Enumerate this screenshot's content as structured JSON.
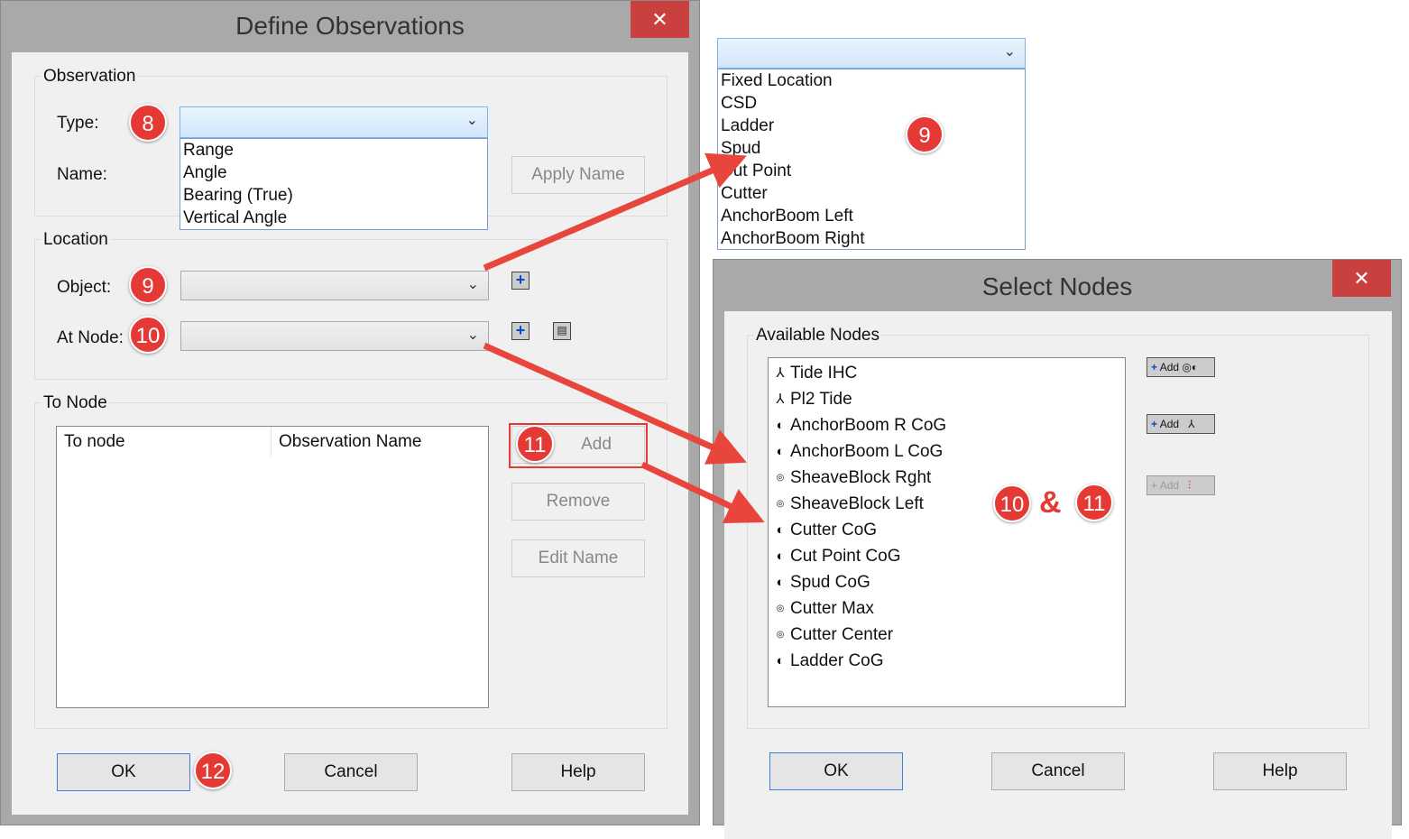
{
  "define": {
    "title": "Define Observations",
    "close": "✕",
    "observation_group": "Observation",
    "type_label": "Type:",
    "name_label": "Name:",
    "apply_name": "Apply Name",
    "type_options": [
      "Range",
      "Angle",
      "Bearing (True)",
      "Vertical Angle"
    ],
    "location_group": "Location",
    "object_label": "Object:",
    "at_node_label": "At Node:",
    "to_node_group": "To Node",
    "columns": [
      "To node",
      "Observation Name"
    ],
    "add": "Add",
    "remove": "Remove",
    "edit_name": "Edit Name",
    "ok": "OK",
    "cancel": "Cancel",
    "help": "Help"
  },
  "object_options": [
    "Fixed Location",
    "CSD",
    "Ladder",
    "Spud",
    "Cut Point",
    "Cutter",
    "AnchorBoom Left",
    "AnchorBoom Right"
  ],
  "select": {
    "title": "Select Nodes",
    "close": "✕",
    "group": "Available Nodes",
    "nodes": [
      {
        "name": "Tide IHC",
        "icon": "tide"
      },
      {
        "name": "Pl2 Tide",
        "icon": "tide"
      },
      {
        "name": "AnchorBoom R CoG",
        "icon": "cog"
      },
      {
        "name": "AnchorBoom L CoG",
        "icon": "cog"
      },
      {
        "name": "SheaveBlock Rght",
        "icon": "point"
      },
      {
        "name": "SheaveBlock Left",
        "icon": "point"
      },
      {
        "name": "Cutter CoG",
        "icon": "cog"
      },
      {
        "name": "Cut Point CoG",
        "icon": "cog"
      },
      {
        "name": "Spud CoG",
        "icon": "cog"
      },
      {
        "name": "Cutter Max",
        "icon": "point"
      },
      {
        "name": "Cutter Center",
        "icon": "point"
      },
      {
        "name": "Ladder CoG",
        "icon": "cog"
      }
    ],
    "add_buttons": [
      "Add",
      "Add",
      "Add"
    ],
    "ok": "OK",
    "cancel": "Cancel",
    "help": "Help"
  },
  "badges": {
    "b8": "8",
    "b9a": "9",
    "b9b": "9",
    "b10a": "10",
    "b10b": "10",
    "b11a": "11",
    "b11b": "11",
    "b12": "12",
    "amp": "&"
  },
  "colors": {
    "badge": "#e53935",
    "arrow": "#e8453c",
    "close": "#c9403f"
  }
}
